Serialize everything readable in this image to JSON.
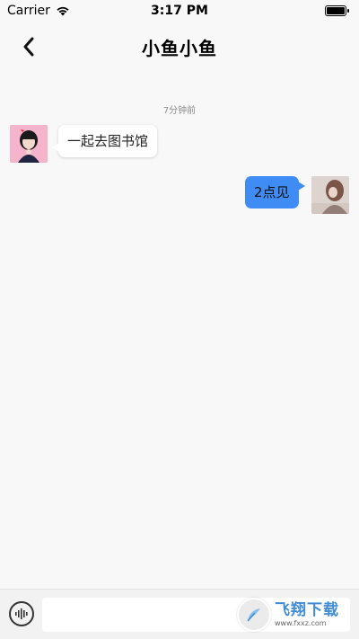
{
  "status_bar": {
    "carrier": "Carrier",
    "time": "3:17 PM",
    "wifi_icon": "wifi-icon",
    "battery_icon": "battery-icon"
  },
  "nav": {
    "back_icon": "chevron-left-icon",
    "title": "小鱼小鱼"
  },
  "chat": {
    "timestamp": "7分钟前",
    "messages": [
      {
        "side": "left",
        "text": "一起去图书馆",
        "avatar": "avatar-girl"
      },
      {
        "side": "right",
        "text": "2点见",
        "avatar": "avatar-self"
      }
    ]
  },
  "input_bar": {
    "voice_icon": "voice-wave-icon",
    "input_value": "",
    "input_placeholder": ""
  },
  "watermark": {
    "text": "飞翔下载",
    "url": "www.fxxz.com"
  },
  "colors": {
    "background": "#f8f8f8",
    "sent_bubble": "#3f8cf4",
    "received_bubble": "#ffffff",
    "timestamp": "#8a8a8a"
  }
}
